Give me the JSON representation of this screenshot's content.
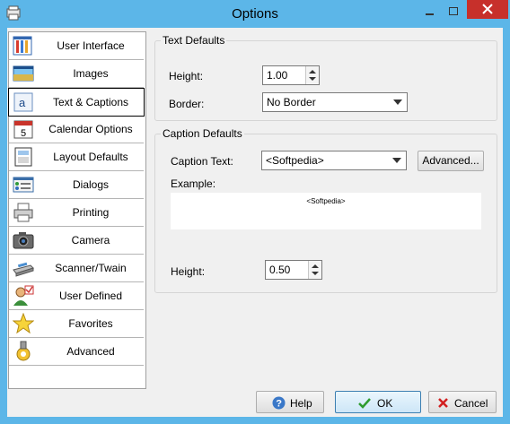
{
  "window": {
    "title": "Options"
  },
  "sidebar": {
    "items": [
      {
        "label": "User Interface",
        "icon": "user-interface-icon"
      },
      {
        "label": "Images",
        "icon": "images-icon"
      },
      {
        "label": "Text & Captions",
        "icon": "text-captions-icon",
        "selected": true
      },
      {
        "label": "Calendar Options",
        "icon": "calendar-icon"
      },
      {
        "label": "Layout Defaults",
        "icon": "layout-icon"
      },
      {
        "label": "Dialogs",
        "icon": "dialogs-icon"
      },
      {
        "label": "Printing",
        "icon": "printer-icon"
      },
      {
        "label": "Camera",
        "icon": "camera-icon"
      },
      {
        "label": "Scanner/Twain",
        "icon": "scanner-icon"
      },
      {
        "label": "User Defined",
        "icon": "user-defined-icon"
      },
      {
        "label": "Favorites",
        "icon": "star-icon"
      },
      {
        "label": "Advanced",
        "icon": "advanced-icon"
      }
    ]
  },
  "text_defaults": {
    "title": "Text Defaults",
    "height_label": "Height:",
    "height_value": "1.00",
    "border_label": "Border:",
    "border_value": "No Border"
  },
  "caption_defaults": {
    "title": "Caption Defaults",
    "caption_text_label": "Caption Text:",
    "caption_text_value": "<Softpedia>",
    "advanced_button": "Advanced...",
    "example_label": "Example:",
    "example_preview": "<Softpedia>",
    "height_label": "Height:",
    "height_value": "0.50"
  },
  "footer": {
    "help_label": "Help",
    "ok_label": "OK",
    "cancel_label": "Cancel"
  },
  "colors": {
    "title_bar": "#5cb6e8",
    "close_button": "#c7302b",
    "client_background": "#f0f0f0",
    "ok_check": "#2e9b2e",
    "cancel_x": "#d21f1f"
  }
}
